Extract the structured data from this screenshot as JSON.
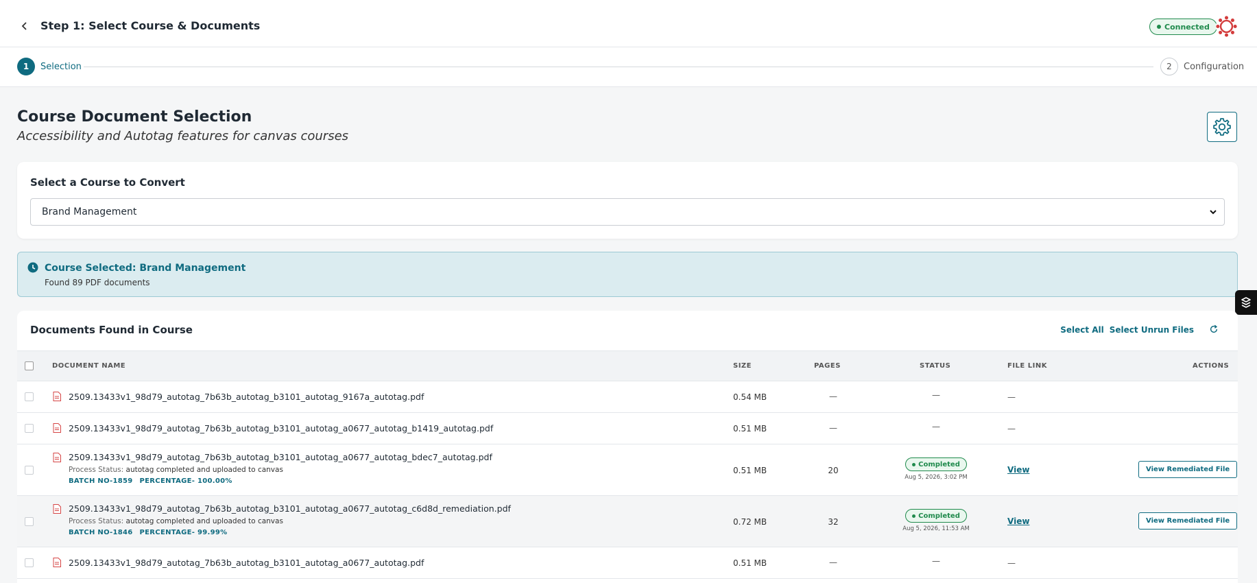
{
  "header": {
    "title": "Step 1: Select Course & Documents",
    "connection_status": "Connected"
  },
  "stepper": {
    "steps": [
      {
        "number": "1",
        "label": "Selection",
        "active": true
      },
      {
        "number": "2",
        "label": "Configuration",
        "active": false
      }
    ]
  },
  "page": {
    "title": "Course Document Selection",
    "subtitle": "Accessibility and Autotag features for canvas courses"
  },
  "course_select": {
    "label": "Select a Course to Convert",
    "selected": "Brand Management"
  },
  "banner": {
    "title": "Course Selected: Brand Management",
    "subtitle": "Found 89 PDF documents"
  },
  "documents": {
    "title": "Documents Found in Course",
    "select_all": "Select All",
    "select_unrun": "Select Unrun Files",
    "columns": {
      "name": "DOCUMENT NAME",
      "size": "SIZE",
      "pages": "PAGES",
      "status": "STATUS",
      "file_link": "FILE LINK",
      "actions": "ACTIONS"
    },
    "process_status_label": "Process Status:",
    "rows": [
      {
        "name": "2509.13433v1_98d79_autotag_7b63b_autotag_b3101_autotag_9167a_autotag.pdf",
        "size": "0.54 MB",
        "pages": "—",
        "status": "—",
        "link": "—"
      },
      {
        "name": "2509.13433v1_98d79_autotag_7b63b_autotag_b3101_autotag_a0677_autotag_b1419_autotag.pdf",
        "size": "0.51 MB",
        "pages": "—",
        "status": "—",
        "link": "—"
      },
      {
        "name": "2509.13433v1_98d79_autotag_7b63b_autotag_b3101_autotag_a0677_autotag_bdec7_autotag.pdf",
        "process_status": "autotag completed and uploaded to canvas",
        "batch": "BATCH NO-1859",
        "percentage": "PERCENTAGE- 100.00%",
        "size": "0.51 MB",
        "pages": "20",
        "status": "Completed",
        "status_date": "Aug 5, 2026, 3:02 PM",
        "link": "View",
        "action": "View Remediated File"
      },
      {
        "name": "2509.13433v1_98d79_autotag_7b63b_autotag_b3101_autotag_a0677_autotag_c6d8d_remediation.pdf",
        "process_status": "autotag completed and uploaded to canvas",
        "batch": "BATCH NO-1846",
        "percentage": "PERCENTAGE- 99.99%",
        "size": "0.72 MB",
        "pages": "32",
        "status": "Completed",
        "status_date": "Aug 5, 2026, 11:53 AM",
        "link": "View",
        "action": "View Remediated File"
      },
      {
        "name": "2509.13433v1_98d79_autotag_7b63b_autotag_b3101_autotag_a0677_autotag.pdf",
        "size": "0.51 MB",
        "pages": "—",
        "status": "—",
        "link": "—"
      }
    ]
  },
  "colors": {
    "accent": "#0f6b80",
    "success": "#1f8a4c",
    "banner_bg": "#dbecf0",
    "pdf_red": "#d64545"
  }
}
